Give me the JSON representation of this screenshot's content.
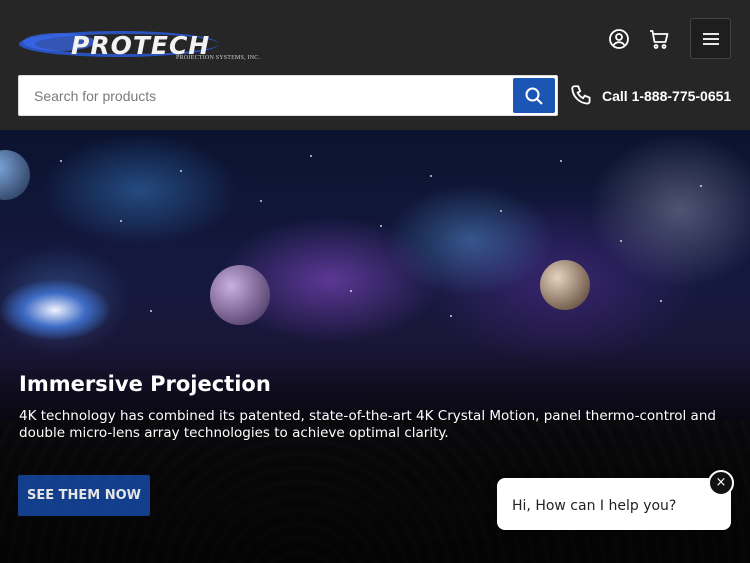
{
  "header": {
    "logo_text": "PROTECH",
    "logo_subtext": "PROJECTION SYSTEMS, INC.",
    "account_icon": "account-icon",
    "cart_icon": "cart-icon",
    "menu_icon": "hamburger-menu-icon"
  },
  "search": {
    "placeholder": "Search for products",
    "value": ""
  },
  "phone": {
    "label": "Call 1-888-775-0651"
  },
  "hero": {
    "title": "Immersive Projection",
    "description": "4K technology has combined its patented, state-of-the-art 4K Crystal Motion, panel thermo-control and double micro-lens array technologies to achieve optimal clarity.",
    "cta_label": "SEE THEM NOW"
  },
  "chat": {
    "message": "Hi, How can I help you?",
    "close_label": "×"
  },
  "colors": {
    "header_bg": "#262626",
    "accent": "#1b56b4",
    "cta_bg": "#15459b"
  }
}
